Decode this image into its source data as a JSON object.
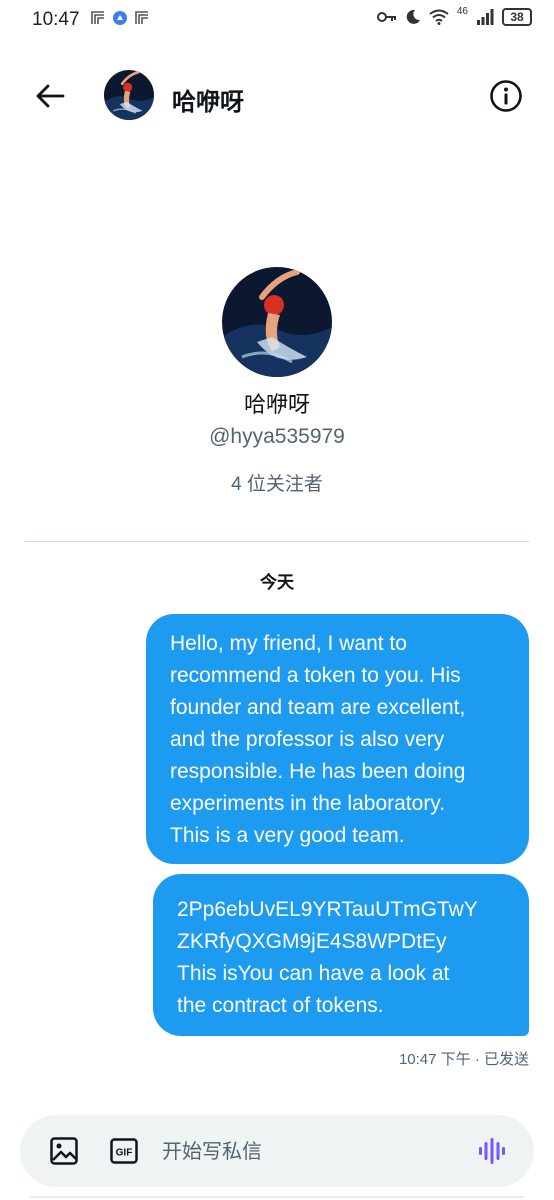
{
  "status_bar": {
    "time": "10:47",
    "battery": "38",
    "network": "46"
  },
  "header": {
    "name": "哈咿呀",
    "icons": {
      "back": "back-arrow-icon",
      "info": "info-icon"
    }
  },
  "profile": {
    "name": "哈咿呀",
    "handle": "@hyya535979",
    "followers": "4 位关注者"
  },
  "date_label": "今天",
  "messages": [
    {
      "lines": [
        "Hello, my friend, I want to",
        "recommend a token to you. His",
        "founder and team are excellent,",
        "and the professor is also very",
        "responsible. He has been doing",
        "experiments in the laboratory.",
        "This is a very good team."
      ]
    },
    {
      "lines": [
        "2Pp6ebUvEL9YRTauUTmGTwY",
        "ZKRfyQXGM9jE4S8WPDtEy",
        "This isYou can have a look at",
        "the contract of tokens."
      ]
    }
  ],
  "message_meta": "10:47 下午 · 已发送",
  "composer": {
    "placeholder": "开始写私信",
    "gif_label": "GIF"
  },
  "colors": {
    "accent": "#1d9bf0",
    "text_secondary": "#536471",
    "composer_bg": "#eff3f4",
    "voice_icon": "#7856ff"
  }
}
